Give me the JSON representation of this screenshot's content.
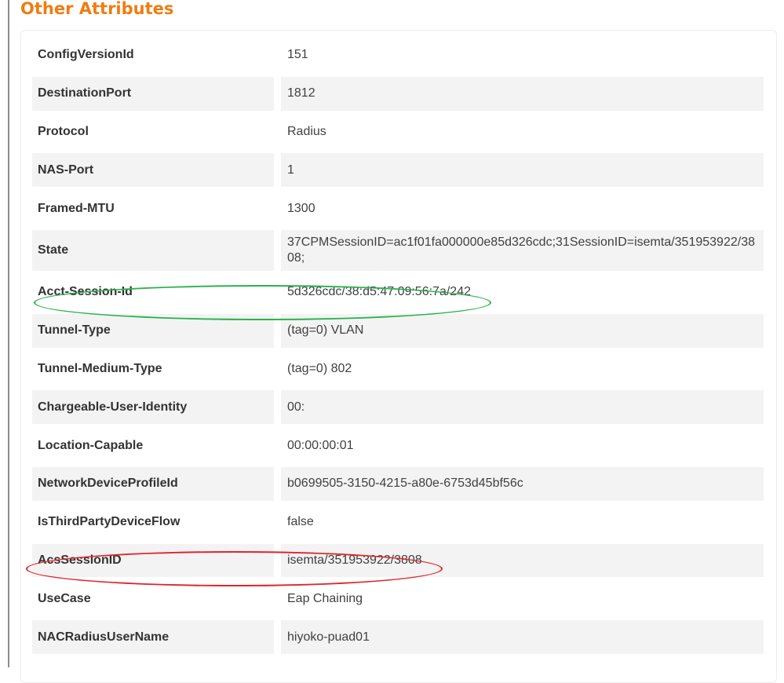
{
  "section": {
    "title": "Other Attributes"
  },
  "attributes": [
    {
      "name": "ConfigVersionId",
      "value": "151"
    },
    {
      "name": "DestinationPort",
      "value": "1812"
    },
    {
      "name": "Protocol",
      "value": "Radius"
    },
    {
      "name": "NAS-Port",
      "value": "1"
    },
    {
      "name": "Framed-MTU",
      "value": "1300"
    },
    {
      "name": "State",
      "value": "37CPMSessionID=ac1f01fa000000e85d326cdc;31SessionID=isemta/351953922/3808;"
    },
    {
      "name": "Acct-Session-Id",
      "value": "5d326cdc/38:d5:47:09:56:7a/242"
    },
    {
      "name": "Tunnel-Type",
      "value": "(tag=0) VLAN"
    },
    {
      "name": "Tunnel-Medium-Type",
      "value": "(tag=0) 802"
    },
    {
      "name": "Chargeable-User-Identity",
      "value": "00:"
    },
    {
      "name": "Location-Capable",
      "value": "00:00:00:01"
    },
    {
      "name": "NetworkDeviceProfileId",
      "value": "b0699505-3150-4215-a80e-6753d45bf56c"
    },
    {
      "name": "IsThirdPartyDeviceFlow",
      "value": "false"
    },
    {
      "name": "AcsSessionID",
      "value": "isemta/351953922/3808"
    },
    {
      "name": "UseCase",
      "value": "Eap Chaining"
    },
    {
      "name": "NACRadiusUserName",
      "value": "hiyoko-puad01"
    }
  ],
  "highlights": {
    "green_color": "#2bb24c",
    "red_color": "#e0242c"
  }
}
